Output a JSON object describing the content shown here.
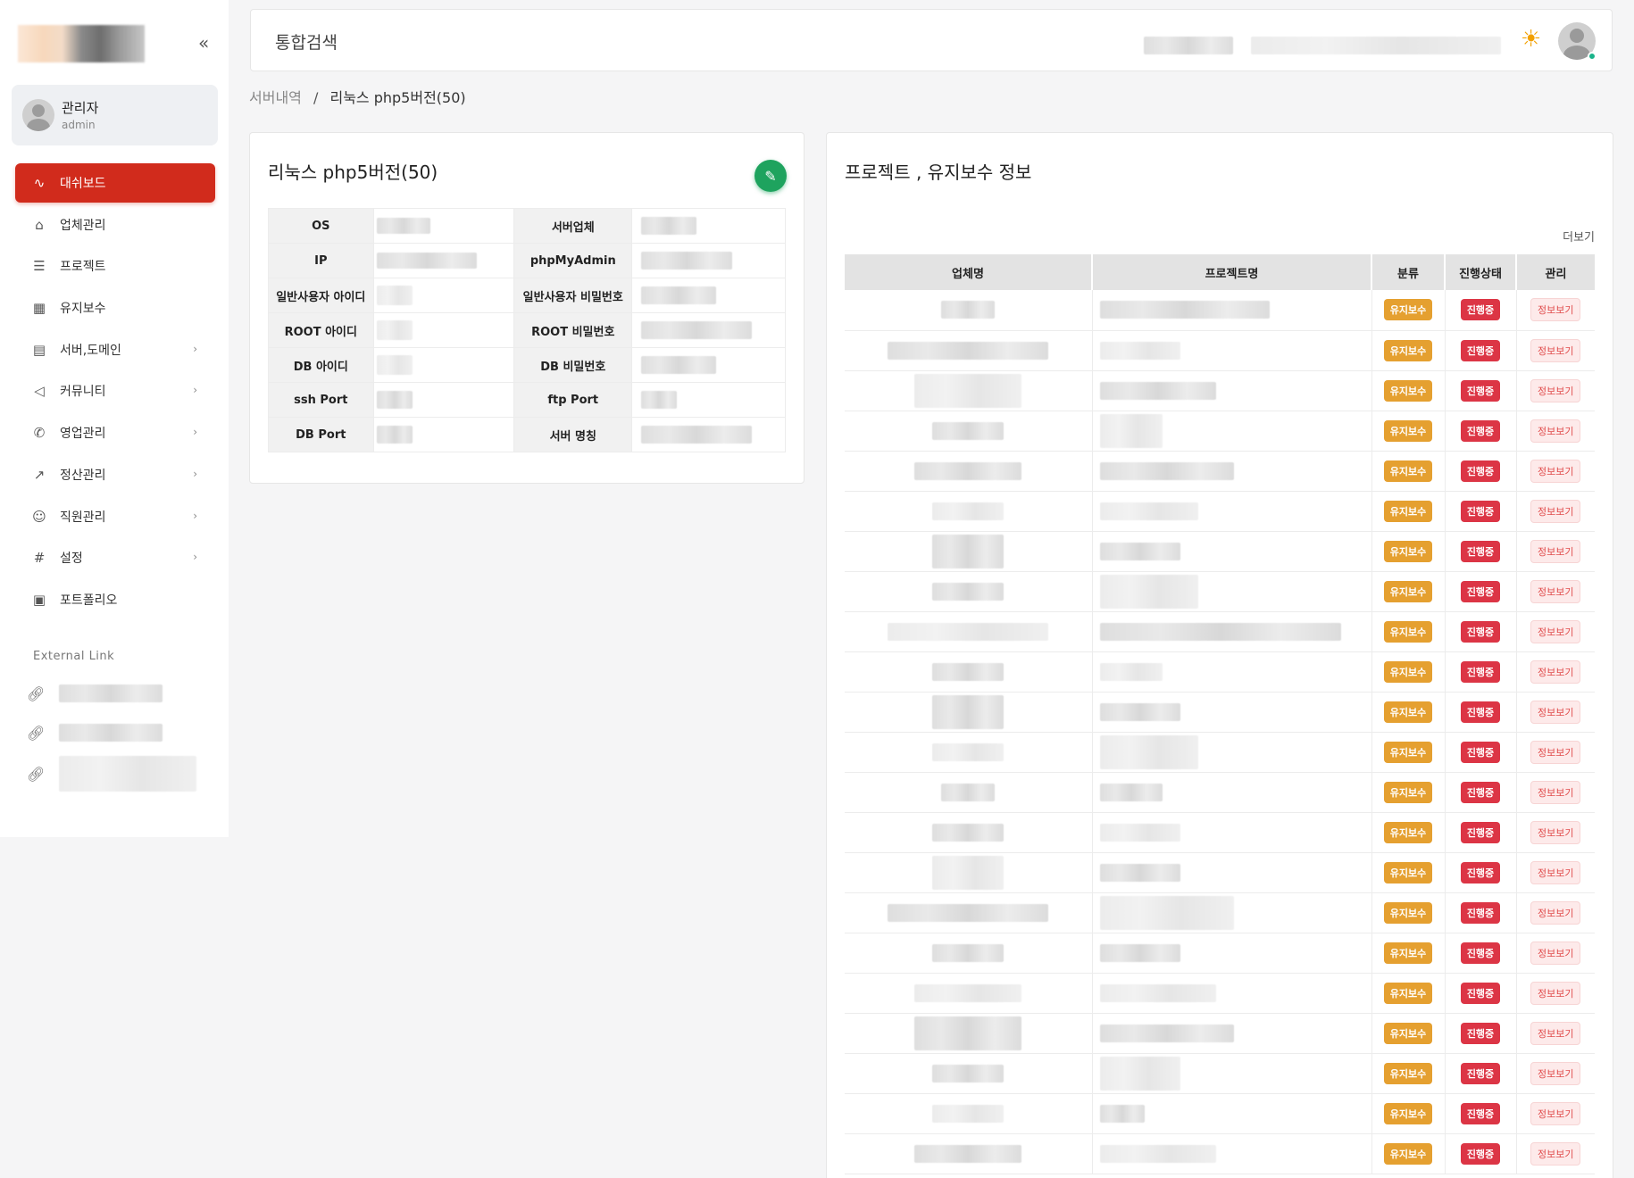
{
  "sidebar": {
    "user": {
      "name": "관리자",
      "role": "admin"
    },
    "items": [
      {
        "label": "대쉬보드",
        "icon": "activity-icon",
        "active": true,
        "has_children": false
      },
      {
        "label": "업체관리",
        "icon": "home-icon",
        "active": false,
        "has_children": false
      },
      {
        "label": "프로젝트",
        "icon": "database-icon",
        "active": false,
        "has_children": false
      },
      {
        "label": "유지보수",
        "icon": "grid-icon",
        "active": false,
        "has_children": false
      },
      {
        "label": "서버,도메인",
        "icon": "server-icon",
        "active": false,
        "has_children": true
      },
      {
        "label": "커뮤니티",
        "icon": "speaker-icon",
        "active": false,
        "has_children": true
      },
      {
        "label": "영업관리",
        "icon": "phone-icon",
        "active": false,
        "has_children": true
      },
      {
        "label": "정산관리",
        "icon": "trending-up-icon",
        "active": false,
        "has_children": true
      },
      {
        "label": "직원관리",
        "icon": "users-icon",
        "active": false,
        "has_children": true
      },
      {
        "label": "설정",
        "icon": "hash-icon",
        "active": false,
        "has_children": true
      },
      {
        "label": "포트폴리오",
        "icon": "image-icon",
        "active": false,
        "has_children": false
      }
    ],
    "external_title": "External Link"
  },
  "header": {
    "search_title": "통합검색"
  },
  "breadcrumb": {
    "parent": "서버내역",
    "separator": "/",
    "current": "리눅스 php5버전(50)"
  },
  "server_card": {
    "title": "리눅스 php5버전(50)",
    "rows": [
      {
        "left_label": "OS",
        "right_label": "서버업체"
      },
      {
        "left_label": "IP",
        "right_label": "phpMyAdmin"
      },
      {
        "left_label": "일반사용자 아이디",
        "right_label": "일반사용자 비밀번호"
      },
      {
        "left_label": "ROOT 아이디",
        "right_label": "ROOT 비밀번호"
      },
      {
        "left_label": "DB 아이디",
        "right_label": "DB 비밀번호"
      },
      {
        "left_label": "ssh Port",
        "right_label": "ftp Port"
      },
      {
        "left_label": "DB Port",
        "right_label": "서버 명칭"
      }
    ]
  },
  "project_card": {
    "title": "프로젝트 , 유지보수 정보",
    "more_label": "더보기",
    "columns": [
      "업체명",
      "프로젝트명",
      "분류",
      "진행상태",
      "관리"
    ],
    "row_count": 22,
    "category_label": "유지보수",
    "status_label": "진행중",
    "action_label": "정보보기"
  },
  "colors": {
    "accent": "#d12b1c",
    "edit": "#1ea35e",
    "maintenance_badge": "#e5a030",
    "progress_badge": "#dc3545"
  }
}
